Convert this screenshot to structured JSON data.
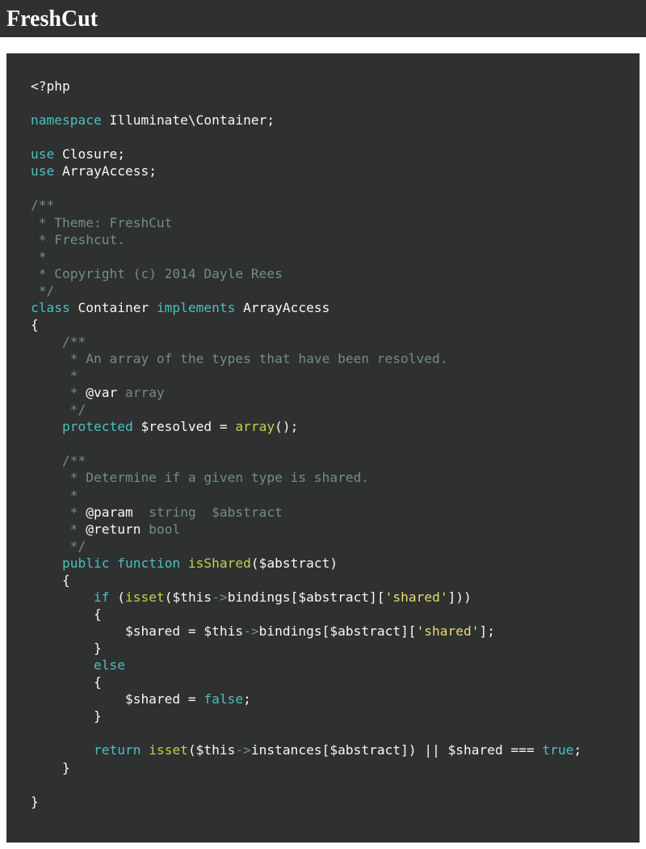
{
  "header": {
    "title": "FreshCut"
  },
  "code": {
    "php_open": "<?php",
    "ns_kw": "namespace",
    "ns_val": " Illuminate\\Container;",
    "use_kw": "use",
    "use1": " Closure;",
    "use2": " ArrayAccess;",
    "doc_top_l1": "/**",
    "doc_top_l2": " * Theme: FreshCut",
    "doc_top_l3": " * Freshcut.",
    "doc_top_l4": " *",
    "doc_top_l5": " * Copyright (c) 2014 Dayle Rees",
    "doc_top_l6": " */",
    "class_kw": "class",
    "class_name": " Container ",
    "implements_kw": "implements",
    "impl_name": " ArrayAccess",
    "brace_open": "{",
    "doc1_l1": "    /**",
    "doc1_l2": "     * An array of the types that have been resolved.",
    "doc1_l3": "     *",
    "doc1_l4a": "     * ",
    "doc1_var": "@var",
    "doc1_arr": " array",
    "doc1_l5": "     */",
    "prot_kw": "    protected",
    "resolved_var": " $resolved = ",
    "array_fn": "array",
    "array_parens": "();",
    "doc2_l1": "    /**",
    "doc2_l2": "     * Determine if a given type is shared.",
    "doc2_l2b": "     *",
    "doc2_l3a": "     * ",
    "doc2_param": "@param",
    "doc2_param_hint": "  string  $abstract",
    "doc2_l4a": "     * ",
    "doc2_return": "@return",
    "doc2_return_hint": " bool",
    "doc2_l5": "     */",
    "pub_kw": "    public",
    "func_kw": " function",
    "func_name": " isShared",
    "func_args": "($abstract)",
    "fn_brace_open": "    {",
    "if_indent": "        ",
    "if_kw": "if",
    "if_paren": " (",
    "isset1": "isset",
    "isset_arg_a": "($this",
    "arrow1": "->",
    "bindings1": "bindings[$abstract][",
    "str_shared1": "'shared'",
    "bindings1_close": "]))",
    "if_body_open": "        {",
    "shared_assign_indent": "            $shared = $this",
    "arrow2": "->",
    "bindings2": "bindings[$abstract][",
    "str_shared2": "'shared'",
    "bindings2_close": "];",
    "if_body_close": "        }",
    "else_indent": "        ",
    "else_kw": "else",
    "else_body_open": "        {",
    "shared_false_a": "            $shared = ",
    "false_kw": "false",
    "shared_false_b": ";",
    "else_body_close": "        }",
    "blank": "",
    "return_indent": "        ",
    "return_kw": "return",
    "return_sp": " ",
    "isset2": "isset",
    "isset2_arg": "($this",
    "arrow3": "->",
    "instances": "instances[$abstract]) || $shared === ",
    "true_kw": "true",
    "semi": ";",
    "fn_brace_close": "    }",
    "class_brace_close": "}"
  }
}
